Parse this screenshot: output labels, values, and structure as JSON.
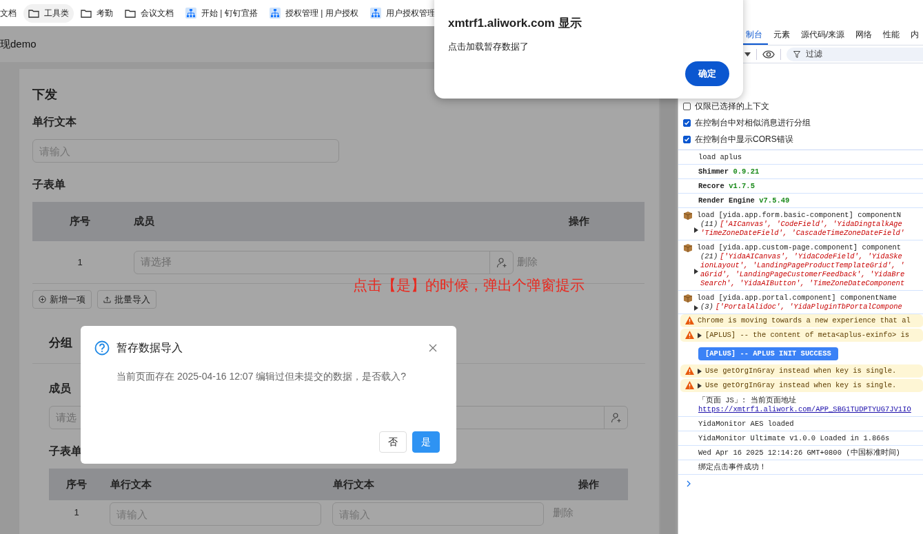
{
  "bookmarks": [
    {
      "label": "文档",
      "kind": "plain",
      "hovered": false
    },
    {
      "label": "工具类",
      "kind": "folder",
      "hovered": true
    },
    {
      "label": "考勤",
      "kind": "folder",
      "hovered": false
    },
    {
      "label": "会议文档",
      "kind": "folder",
      "hovered": false
    },
    {
      "label": "开始 | 钉钉宜搭",
      "kind": "app",
      "hovered": false
    },
    {
      "label": "授权管理 | 用户授权",
      "kind": "app",
      "hovered": false
    },
    {
      "label": "用户授权管理",
      "kind": "app",
      "hovered": false
    }
  ],
  "page": {
    "title": "现demo",
    "section1": {
      "title": "下发",
      "text_field": {
        "label": "单行文本",
        "placeholder": "请输入"
      },
      "subform": {
        "label": "子表单",
        "columns": [
          "序号",
          "成员",
          "操作"
        ],
        "rows": [
          {
            "index": "1",
            "placeholder": "请选择",
            "action": "删除"
          }
        ],
        "buttons": [
          {
            "label": "新增一项",
            "kind": "add"
          },
          {
            "label": "批量导入",
            "kind": "import"
          }
        ]
      }
    },
    "section2": {
      "title": "分组",
      "member": {
        "label": "成员",
        "placeholder": "请选"
      },
      "subform": {
        "label": "子表单",
        "columns": [
          "序号",
          "单行文本",
          "单行文本",
          "操作"
        ],
        "rows": [
          {
            "index": "1",
            "placeholders": [
              "请输入",
              "请输入"
            ],
            "action": "删除"
          }
        ]
      }
    }
  },
  "annotation": "点击【是】的时候，弹出个弹窗提示",
  "modal": {
    "title": "暂存数据导入",
    "message": "当前页面存在 2025-04-16 12:07 编辑过但未提交的数据，是否载入?",
    "buttons": [
      {
        "label": "否",
        "kind": "secondary"
      },
      {
        "label": "是",
        "kind": "primary"
      }
    ]
  },
  "alert": {
    "title": "xmtrf1.aliwork.com 显示",
    "message": "点击加载暂存数据了",
    "button": "确定"
  },
  "devtools": {
    "tabs": [
      {
        "label": "制台",
        "selected": true
      },
      {
        "label": "元素",
        "selected": false
      },
      {
        "label": "源代码/来源",
        "selected": false
      },
      {
        "label": "网络",
        "selected": false
      },
      {
        "label": "性能",
        "selected": false
      },
      {
        "label": "内",
        "selected": false
      }
    ],
    "filter": {
      "placeholder": "过滤"
    },
    "settings": [
      {
        "label": "仅限已选择的上下文",
        "checked": false
      },
      {
        "label": "在控制台中对相似消息进行分组",
        "checked": true
      },
      {
        "label": "在控制台中显示CORS错误",
        "checked": true
      }
    ],
    "messages": [
      {
        "kind": "plain",
        "text": "load aplus"
      },
      {
        "kind": "version",
        "text": "Shimmer",
        "version": "0.9.21"
      },
      {
        "kind": "version",
        "text": "Recore",
        "version": "v1.7.5"
      },
      {
        "kind": "version",
        "text": "Render Engine",
        "version": "v7.5.49"
      },
      {
        "kind": "group",
        "text": "load [yida.app.form.basic-component] componentN",
        "count": "(11)",
        "lines": [
          "['AICanvas', 'CodeField', 'YidaDingtalkAge",
          "'TimeZoneDateField', 'CascadeTimeZoneDateField'"
        ]
      },
      {
        "kind": "group",
        "text": "load [yida.app.custom-page.component] component",
        "count": "(21)",
        "lines": [
          "['YidaAICanvas', 'YidaCodeField', 'YidaSke",
          "ionLayout', 'LandingPageProductTemplateGrid', '",
          "aGrid', 'LandingPageCustomerFeedback', 'YidaBre",
          "Search', 'YidaAIButton', 'TimeZoneDateComponent"
        ]
      },
      {
        "kind": "group",
        "text": "load [yida.app.portal.component] componentName",
        "count": "(3)",
        "lines": [
          "['PortalAlidoc', 'YidaPluginTbPortalCompone"
        ]
      },
      {
        "kind": "warning",
        "text": "Chrome is moving towards a new experience that al",
        "expandable": false
      },
      {
        "kind": "warning",
        "text": "[APLUS] -- the content of meta<aplus-exinfo> is",
        "expandable": true
      },
      {
        "kind": "badge",
        "text": "[APLUS] -- APLUS INIT SUCCESS"
      },
      {
        "kind": "warning",
        "text": "Use getOrgInGray instead when key is single.",
        "expandable": true
      },
      {
        "kind": "warning",
        "text": "Use getOrgInGray instead when key is single.",
        "expandable": true
      },
      {
        "kind": "link",
        "text": "「页面 JS」: 当前页面地址",
        "link": "https://xmtrf1.aliwork.com/APP_SBG1TUDPTYUG7JV1IO"
      },
      {
        "kind": "plain",
        "text": "YidaMonitor AES loaded"
      },
      {
        "kind": "plain",
        "text": "YidaMonitor Ultimate v1.0.0 Loaded in 1.866s"
      },
      {
        "kind": "plain",
        "text": "Wed Apr 16 2025 12:14:26 GMT+0800 (中国标准时间)"
      },
      {
        "kind": "plain",
        "text": "绑定点击事件成功！"
      }
    ]
  }
}
